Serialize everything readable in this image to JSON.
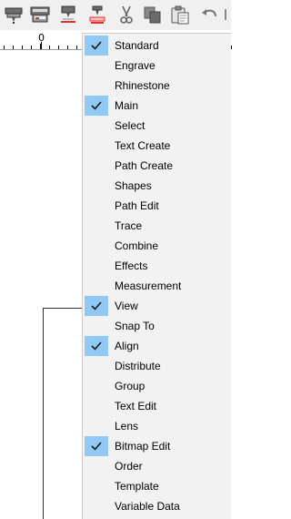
{
  "toolbar": {
    "icons": [
      "plotter-icon",
      "plotter-setup-icon",
      "cut-icon",
      "print-and-cut-icon",
      "scissors-icon",
      "copy-icon",
      "paste-icon",
      "undo-icon"
    ]
  },
  "ruler": {
    "zero_label": "0"
  },
  "menu": {
    "items": [
      {
        "label": "Standard",
        "checked": true
      },
      {
        "label": "Engrave",
        "checked": false
      },
      {
        "label": "Rhinestone",
        "checked": false
      },
      {
        "label": "Main",
        "checked": true
      },
      {
        "label": "Select",
        "checked": false
      },
      {
        "label": "Text Create",
        "checked": false
      },
      {
        "label": "Path Create",
        "checked": false
      },
      {
        "label": "Shapes",
        "checked": false
      },
      {
        "label": "Path Edit",
        "checked": false
      },
      {
        "label": "Trace",
        "checked": false
      },
      {
        "label": "Combine",
        "checked": false
      },
      {
        "label": "Effects",
        "checked": false
      },
      {
        "label": "Measurement",
        "checked": false
      },
      {
        "label": "View",
        "checked": true
      },
      {
        "label": "Snap To",
        "checked": false
      },
      {
        "label": "Align",
        "checked": true
      },
      {
        "label": "Distribute",
        "checked": false
      },
      {
        "label": "Group",
        "checked": false
      },
      {
        "label": "Text Edit",
        "checked": false
      },
      {
        "label": "Lens",
        "checked": false
      },
      {
        "label": "Bitmap Edit",
        "checked": true
      },
      {
        "label": "Order",
        "checked": false
      },
      {
        "label": "Template",
        "checked": false
      },
      {
        "label": "Variable Data",
        "checked": false
      }
    ]
  }
}
